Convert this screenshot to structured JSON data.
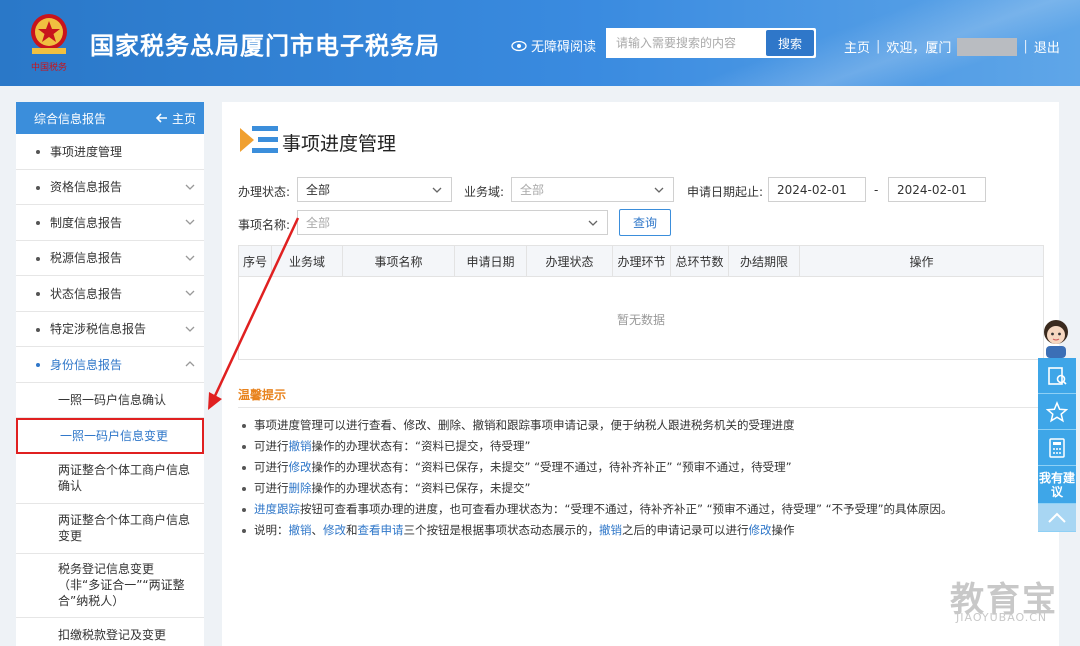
{
  "header": {
    "title": "国家税务总局厦门市电子税务局",
    "accessibility": "无障碍阅读",
    "search_placeholder": "请输入需要搜索的内容",
    "search_button": "搜索",
    "home": "主页",
    "welcome": "欢迎，厦门",
    "logout": "退出",
    "emblem_text": "中国税务"
  },
  "sidebar": {
    "header": "综合信息报告",
    "home": "主页",
    "items": [
      {
        "label": "事项进度管理"
      },
      {
        "label": "资格信息报告"
      },
      {
        "label": "制度信息报告"
      },
      {
        "label": "税源信息报告"
      },
      {
        "label": "状态信息报告"
      },
      {
        "label": "特定涉税信息报告"
      },
      {
        "label": "身份信息报告"
      }
    ],
    "sub_items": [
      {
        "label": "一照一码户信息确认"
      },
      {
        "label": "一照一码户信息变更"
      },
      {
        "label": "两证整合个体工商户信息确认"
      },
      {
        "label": "两证整合个体工商户信息变更"
      },
      {
        "label": "税务登记信息变更（非“多证合一”“两证整合”纳税人）"
      },
      {
        "label": "扣缴税款登记及变更"
      }
    ]
  },
  "main": {
    "title": "事项进度管理",
    "filters": {
      "status_label": "办理状态:",
      "status_value": "全部",
      "domain_label": "业务域:",
      "domain_placeholder": "全部",
      "date_label": "申请日期起止:",
      "date_from": "2024-02-01",
      "date_sep": "-",
      "date_to": "2024-02-01",
      "name_label": "事项名称:",
      "name_placeholder": "全部",
      "query_button": "查询"
    },
    "table": {
      "columns": [
        "序号",
        "业务域",
        "事项名称",
        "申请日期",
        "办理状态",
        "办理环节",
        "总环节数",
        "办结期限",
        "操作"
      ],
      "empty_text": "暂无数据"
    },
    "tips": {
      "title": "温馨提示",
      "t1": "事项进度管理可以进行查看、修改、删除、撤销和跟踪事项申请记录，便于纳税人跟进税务机关的受理进度",
      "t2_a": "可进行",
      "t2_link": "撤销",
      "t2_b": "操作的办理状态有：“资料已提交，待受理”",
      "t3_a": "可进行",
      "t3_link": "修改",
      "t3_b": "操作的办理状态有：“资料已保存，未提交”   “受理不通过，待补齐补正”   “预审不通过，待受理”",
      "t4_a": "可进行",
      "t4_link": "删除",
      "t4_b": "操作的办理状态有：“资料已保存，未提交”",
      "t5_link": "进度跟踪",
      "t5_b": "按钮可查看事项办理的进度，也可查看办理状态为：“受理不通过，待补齐补正”   “预审不通过，待受理”   “不予受理”的具体原因。",
      "t6_a": "说明：",
      "t6_l1": "撤销",
      "t6_s1": "、",
      "t6_l2": "修改",
      "t6_s2": "和",
      "t6_l3": "查看申请",
      "t6_b": "三个按钮是根据事项状态动态展示的，",
      "t6_l4": "撤销",
      "t6_c": "之后的申请记录可以进行",
      "t6_l5": "修改",
      "t6_d": "操作"
    }
  },
  "float_bar": {
    "suggest": "我有建议"
  },
  "watermark": {
    "main": "教育宝",
    "sub": "JIAOYUBAO.CN"
  },
  "colors": {
    "brand": "#3b8edb",
    "link": "#2f77c9",
    "tips_title": "#e8831e",
    "highlight_box": "#e02020"
  }
}
